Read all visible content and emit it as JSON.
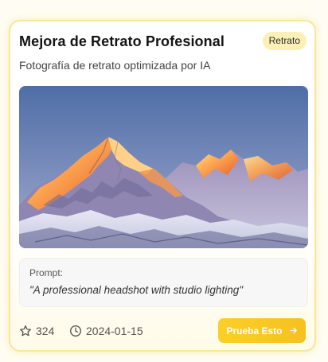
{
  "card": {
    "title": "Mejora de Retrato Profesional",
    "badge": "Retrato",
    "subtitle": "Fotografía de retrato optimizada por IA",
    "image": {
      "subject": "sunlit snowy mountain range at golden hour"
    },
    "prompt": {
      "label": "Prompt:",
      "text": "\"A professional headshot with studio lighting\""
    },
    "stats": {
      "likes": "324",
      "likes_icon": "star-icon",
      "date": "2024-01-15",
      "date_icon": "clock-icon"
    },
    "cta": {
      "label": "Prueba Esto",
      "icon": "arrow-right-icon"
    }
  },
  "colors": {
    "accent": "#f8c723",
    "badge_background": "#fdf0b6",
    "card_border": "#f7e79a",
    "page_background": "#fffdf3"
  }
}
